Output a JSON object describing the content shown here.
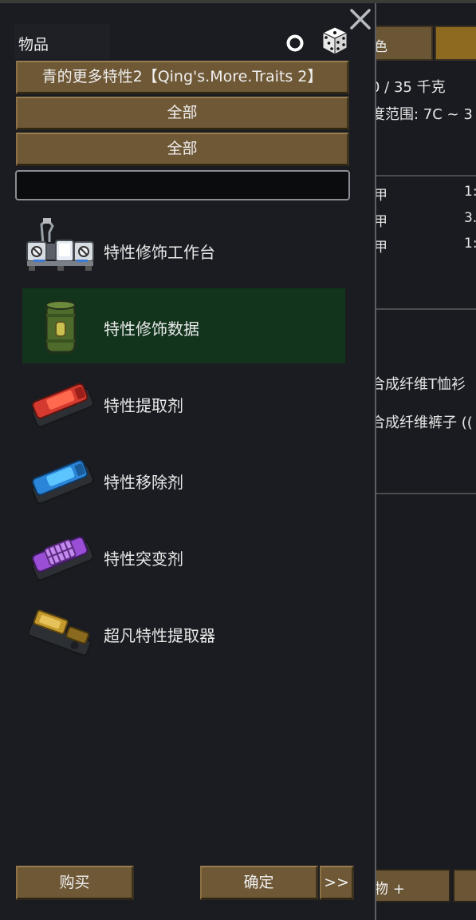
{
  "background": {
    "tab1_label": "色",
    "weight": "0 / 35 千克",
    "comfort_range": "度范围: 7C ~ 3",
    "stats": [
      {
        "label": "甲",
        "value": "1:"
      },
      {
        "label": "甲",
        "value": "3."
      },
      {
        "label": "甲",
        "value": "1:"
      }
    ],
    "apparel": [
      "合成纤维T恤衫",
      "合成纤维裤子 (("
    ],
    "bottom_button": "物 +"
  },
  "dialog": {
    "title": "物品",
    "source_filter": "青的更多特性2【Qing's.More.Traits 2】",
    "category_filter": "全部",
    "subcategory_filter": "全部",
    "search": {
      "value": "",
      "placeholder": ""
    },
    "items": [
      {
        "label": "特性修饰工作台",
        "icon": "workbench-icon",
        "selected": false
      },
      {
        "label": "特性修饰数据",
        "icon": "barrel-icon",
        "selected": true
      },
      {
        "label": "特性提取剂",
        "icon": "red-injector-icon",
        "selected": false
      },
      {
        "label": "特性移除剂",
        "icon": "blue-injector-icon",
        "selected": false
      },
      {
        "label": "特性突变剂",
        "icon": "purple-injector-icon",
        "selected": false
      },
      {
        "label": "超凡特性提取器",
        "icon": "gold-extractor-icon",
        "selected": false
      }
    ],
    "buttons": {
      "buy": "购买",
      "confirm": "确定",
      "next": ">>"
    }
  },
  "colors": {
    "button": "#6f5836",
    "selected_row": "#12341c",
    "background": "#1a1c21"
  }
}
